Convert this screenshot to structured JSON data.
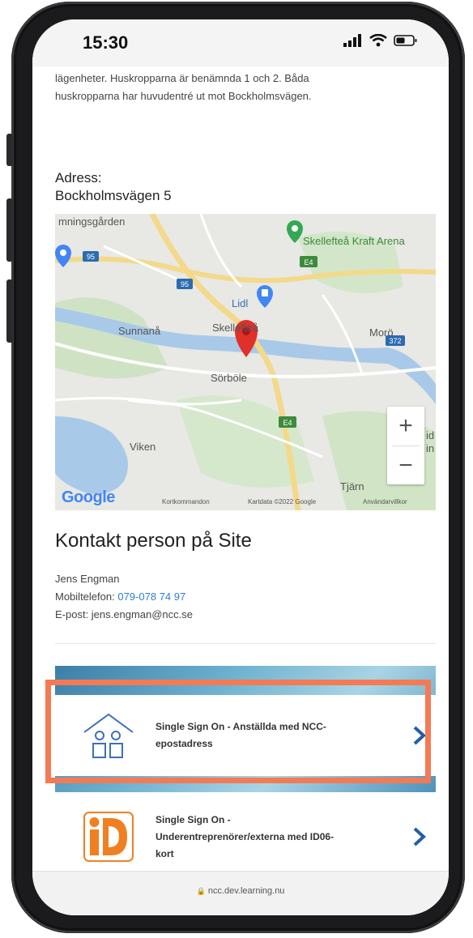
{
  "status_bar": {
    "time": "15:30"
  },
  "page": {
    "intro_line_1": "lägenheter. Huskropparna är benämnda 1 och 2. Båda",
    "intro_line_2": "huskropparna har huvudentré ut mot Bockholmsvägen.",
    "address_label": "Adress:",
    "address_value": "Bockholmsvägen 5"
  },
  "map": {
    "labels": {
      "top_left": "mningsgården",
      "arena": "Skellefteå Kraft Arena",
      "lidl": "Lidl",
      "sunnana": "Sunnanå",
      "city": "Skellefteå",
      "moro": "Morö",
      "sorbole": "Sörböle",
      "viken": "Viken",
      "tjarn": "Tjärn",
      "edge_id": "id",
      "edge_in": "in"
    },
    "road_badges": {
      "e4_top": "E4",
      "r95": "95",
      "r372": "372",
      "e4_bottom": "E4",
      "badge_left": "95"
    },
    "zoom_in": "+",
    "zoom_out": "−",
    "google_logo": "Google",
    "footer": {
      "shortcuts": "Kortkommandon",
      "map_data": "Kartdata ©2022 Google",
      "terms": "Användarvillkor"
    }
  },
  "contact": {
    "heading": "Kontakt person på Site",
    "name": "Jens Engman",
    "mobile_label": "Mobiltelefon:",
    "mobile_value": "079-078 74 97",
    "email": "E-post: jens.engman@ncc.se"
  },
  "login": {
    "sso_employees_line_1": "Single Sign On - Anställda med NCC-",
    "sso_employees_line_2": "epostadress",
    "sso_external_line_1": "Single Sign On -",
    "sso_external_line_2": "Underentreprenörer/externa med ID06-",
    "sso_external_line_3": "kort"
  },
  "browser": {
    "url": "ncc.dev.learning.nu"
  },
  "colors": {
    "highlight": "#f47a55",
    "link": "#2b7fd6",
    "chevron": "#1f5fa8",
    "id06_orange": "#f07f22",
    "marker_red": "#e0302a"
  }
}
